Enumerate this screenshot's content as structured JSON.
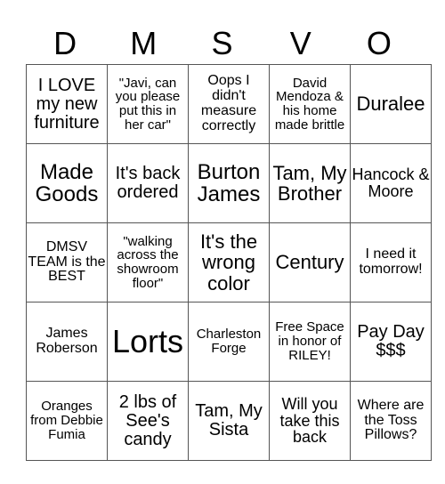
{
  "header": {
    "letters": [
      "D",
      "M",
      "S",
      "V",
      "O"
    ]
  },
  "cells": [
    [
      "I LOVE my new furniture",
      "\"Javi, can you please put this in her car\"",
      "Oops I didn't measure correctly",
      "David Mendoza & his home made brittle",
      "Duralee"
    ],
    [
      "Made Goods",
      "It's back ordered",
      "Burton James",
      "Tam, My Brother",
      "Hancock & Moore"
    ],
    [
      "DMSV TEAM is the BEST",
      "\"walking across the showroom floor\"",
      "It's the wrong color",
      "Century",
      "I need it tomorrow!"
    ],
    [
      "James Roberson",
      "Lorts",
      "Charleston Forge",
      "Free Space in honor of RILEY!",
      "Pay Day $$$"
    ],
    [
      "Oranges from Debbie Fumia",
      "2 lbs of See's candy",
      "Tam, My Sista",
      "Will you take this back",
      "Where are the Toss Pillows?"
    ]
  ]
}
